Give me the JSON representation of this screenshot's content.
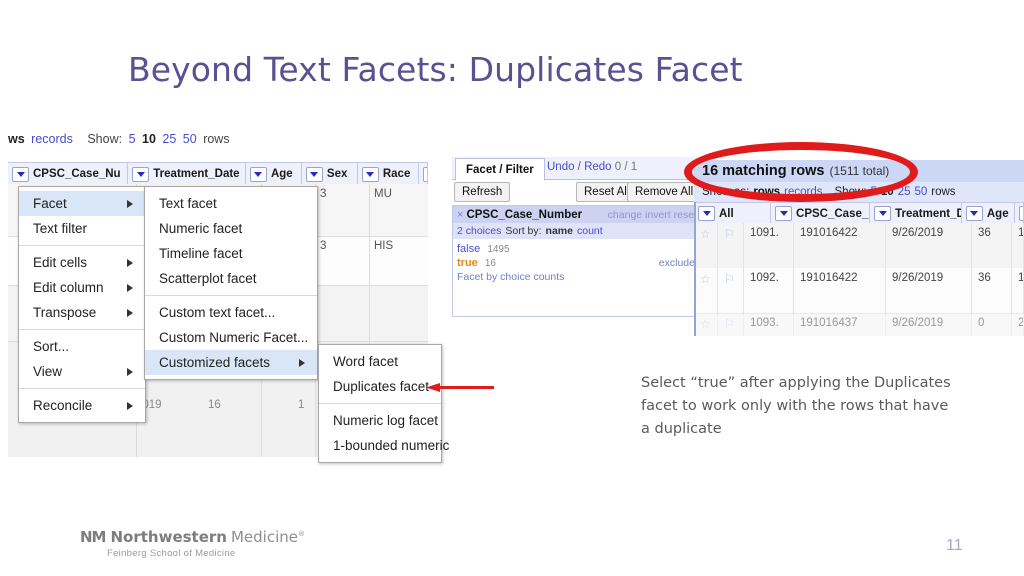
{
  "slide": {
    "title": "Beyond Text Facets: Duplicates Facet",
    "page_number": "11",
    "accent_color": "#5b5192",
    "annotation_color": "#e01b1b"
  },
  "left_shot": {
    "rows_bar": {
      "rows_label": "ws",
      "records_label": "records",
      "show_label": "Show:",
      "option_5": "5",
      "option_10": "10",
      "option_25": "25",
      "option_50": "50",
      "rows_suffix": "rows"
    },
    "columns": [
      {
        "label": "CPSC_Case_Nu"
      },
      {
        "label": "Treatment_Date"
      },
      {
        "label": "Age"
      },
      {
        "label": "Sex"
      },
      {
        "label": "Race"
      },
      {
        "label": ""
      }
    ],
    "cells": {
      "age_1": "3",
      "race_1": "MU",
      "age_2": "3",
      "race_2": "HIS",
      "date_partial": "2019",
      "age_partial": "16",
      "sex_partial": "1"
    }
  },
  "menu_primary": {
    "items": [
      {
        "label": "Facet",
        "submenu": true,
        "selected": true
      },
      {
        "label": "Text filter",
        "submenu": false,
        "selected": false
      },
      {
        "separator": true
      },
      {
        "label": "Edit cells",
        "submenu": true,
        "selected": false
      },
      {
        "label": "Edit column",
        "submenu": true,
        "selected": false
      },
      {
        "label": "Transpose",
        "submenu": true,
        "selected": false
      },
      {
        "separator": true
      },
      {
        "label": "Sort...",
        "submenu": false,
        "selected": false
      },
      {
        "label": "View",
        "submenu": true,
        "selected": false
      },
      {
        "separator": true
      },
      {
        "label": "Reconcile",
        "submenu": true,
        "selected": false
      }
    ]
  },
  "menu_facet": {
    "items": [
      {
        "label": "Text facet",
        "submenu": false,
        "selected": false
      },
      {
        "label": "Numeric facet",
        "submenu": false,
        "selected": false
      },
      {
        "label": "Timeline facet",
        "submenu": false,
        "selected": false
      },
      {
        "label": "Scatterplot facet",
        "submenu": false,
        "selected": false
      },
      {
        "separator": true
      },
      {
        "label": "Custom text facet...",
        "submenu": false,
        "selected": false
      },
      {
        "label": "Custom Numeric Facet...",
        "submenu": false,
        "selected": false
      },
      {
        "label": "Customized facets",
        "submenu": true,
        "selected": true
      }
    ]
  },
  "menu_customized": {
    "items": [
      {
        "label": "Word facet",
        "submenu": false,
        "selected": false
      },
      {
        "label": "Duplicates facet",
        "submenu": false,
        "selected": false
      },
      {
        "separator": true
      },
      {
        "label": "Numeric log facet",
        "submenu": false,
        "selected": false
      },
      {
        "label": "1-bounded numeric",
        "submenu": false,
        "selected": false
      }
    ]
  },
  "facet_panel": {
    "tab_active": "Facet / Filter",
    "tab_undo": "Undo / Redo",
    "undo_count": "0 / 1",
    "refresh_button": "Refresh",
    "reset_all_button": "Reset All",
    "remove_all_button": "Remove All",
    "facet_name": "CPSC_Case_Number",
    "close_icon": "×",
    "action_change": "change",
    "action_invert": "invert",
    "action_reset": "reset",
    "choices_label": "2 choices",
    "sort_by_label": "Sort by:",
    "sort_name": "name",
    "sort_count": "count",
    "choices": [
      {
        "value": "false",
        "count": "1495",
        "color": "#4a4ad0",
        "exclude": ""
      },
      {
        "value": "true",
        "count": "16",
        "color": "#e08a1e",
        "exclude": "exclude"
      }
    ],
    "facet_by_counts": "Facet by choice counts"
  },
  "right_shot": {
    "matching_rows": "16 matching rows",
    "total": "(1511 total)",
    "show_as_label": "Show as:",
    "show_as_rows": "rows",
    "show_as_records": "records",
    "show_label": "Show:",
    "option_5": "5",
    "option_10": "10",
    "option_25": "25",
    "option_50": "50",
    "rows_suffix": "rows",
    "columns": [
      {
        "label": "All"
      },
      {
        "label": "CPSC_Case_Number"
      },
      {
        "label": "Treatment_Date"
      },
      {
        "label": "Age"
      },
      {
        "label": ""
      }
    ],
    "rows": [
      {
        "index": "1091.",
        "case_number": "191016422",
        "date": "9/26/2019",
        "age": "36",
        "extra": "1"
      },
      {
        "index": "1092.",
        "case_number": "191016422",
        "date": "9/26/2019",
        "age": "36",
        "extra": "1"
      },
      {
        "index": "1093.",
        "case_number": "191016437",
        "date": "9/26/2019",
        "age": "0",
        "extra": "2"
      }
    ]
  },
  "annotations": {
    "note_text": "Select “true” after applying the Duplicates facet to work only with the rows that have a duplicate"
  },
  "footer": {
    "logo_mark": "NM",
    "logo_bold": "Northwestern",
    "logo_light": "Medicine",
    "logo_reg": "®",
    "logo_sub": "Feinberg School of Medicine"
  }
}
